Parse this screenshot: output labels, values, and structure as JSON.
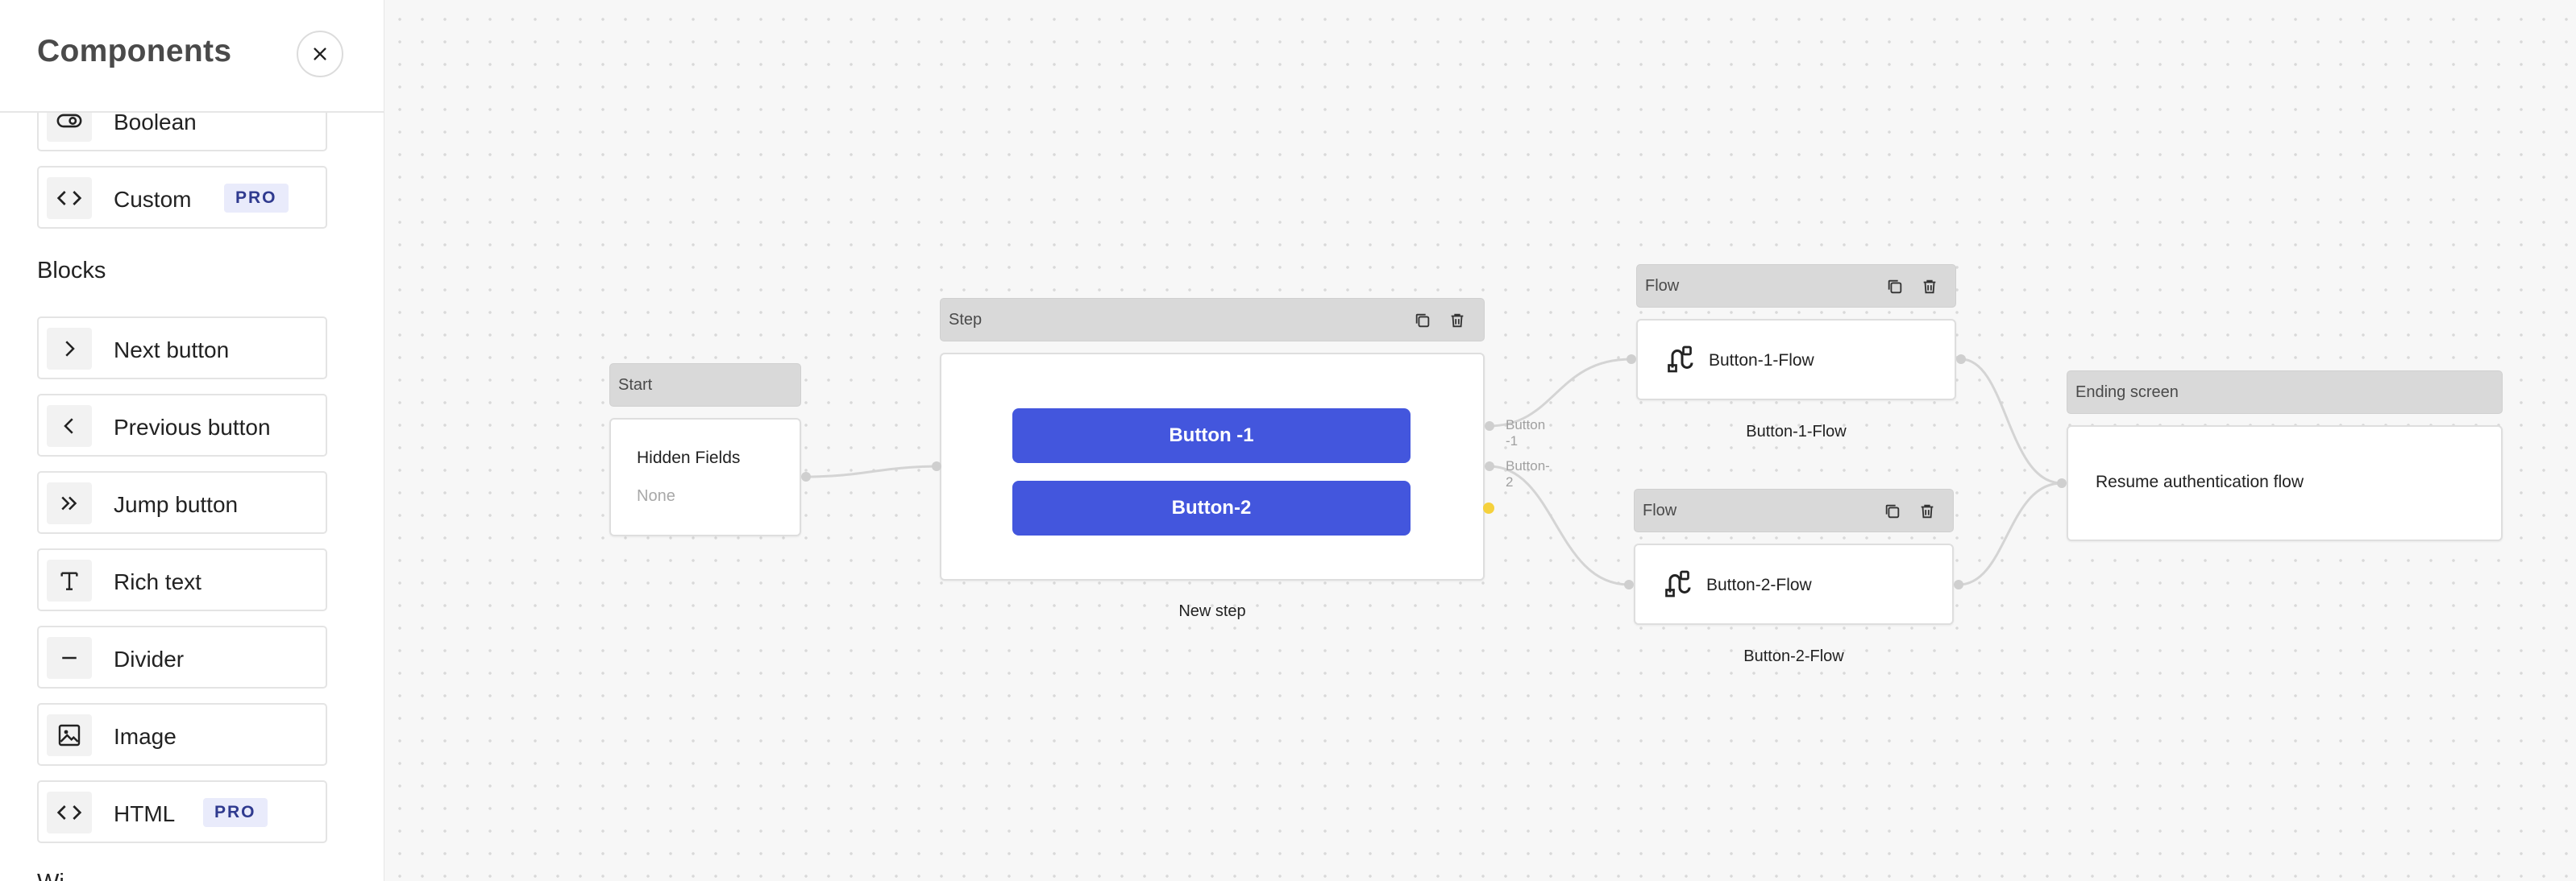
{
  "sidebar": {
    "title": "Components",
    "components_top": [
      {
        "label": "Boolean",
        "icon": "toggle-icon"
      },
      {
        "label": "Custom",
        "icon": "code-icon",
        "badge": "PRO"
      }
    ],
    "blocks_title": "Blocks",
    "blocks": [
      {
        "label": "Next button",
        "icon": "chevron-right-icon"
      },
      {
        "label": "Previous button",
        "icon": "chevron-left-icon"
      },
      {
        "label": "Jump button",
        "icon": "double-chevron-right-icon"
      },
      {
        "label": "Rich text",
        "icon": "text-icon"
      },
      {
        "label": "Divider",
        "icon": "divider-icon"
      },
      {
        "label": "Image",
        "icon": "image-icon"
      },
      {
        "label": "HTML",
        "icon": "code-icon",
        "badge": "PRO"
      }
    ],
    "next_section_title": "Wi"
  },
  "flow": {
    "start": {
      "header": "Start",
      "field_label": "Hidden Fields",
      "field_value": "None"
    },
    "step": {
      "header": "Step",
      "buttons": [
        "Button -1",
        "Button-2"
      ],
      "caption": "New step"
    },
    "edge_labels": [
      "Button -1",
      "Button-2"
    ],
    "flow1": {
      "header": "Flow",
      "label": "Button-1-Flow",
      "caption": "Button-1-Flow"
    },
    "flow2": {
      "header": "Flow",
      "label": "Button-2-Flow",
      "caption": "Button-2-Flow"
    },
    "ending": {
      "header": "Ending screen",
      "text": "Resume authentication flow"
    }
  },
  "colors": {
    "primary_button": "#4356dd",
    "pro_badge_bg": "#e9ebfb",
    "pro_badge_text": "#2f3a8f",
    "handle_active": "#f5d13d"
  }
}
